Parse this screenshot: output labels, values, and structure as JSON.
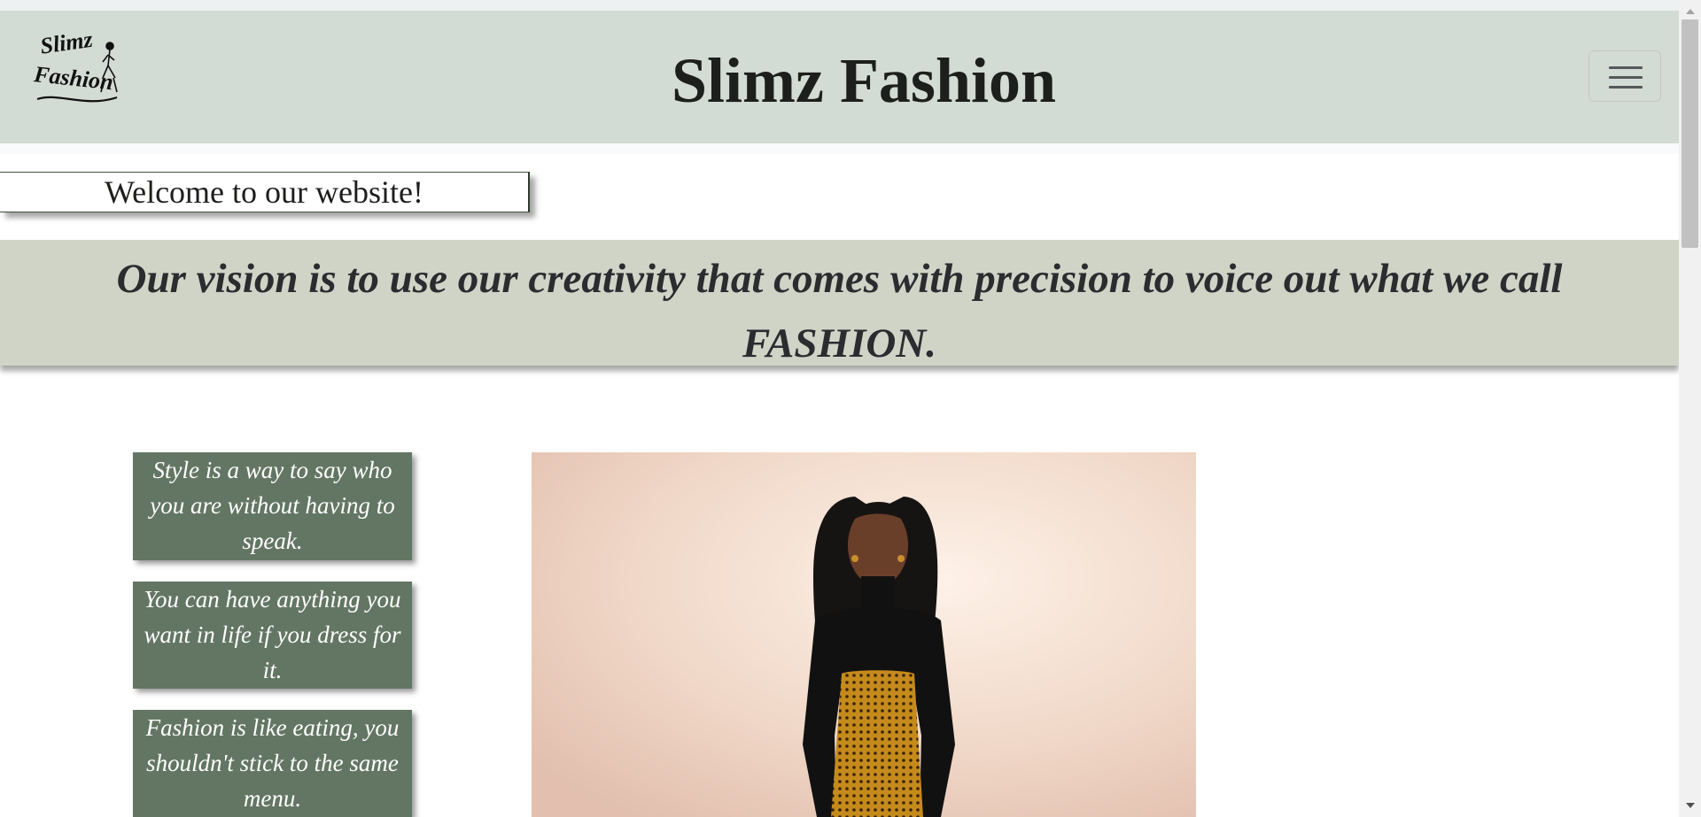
{
  "header": {
    "title": "Slimz Fashion",
    "logo_lines": [
      "Slimz",
      "Fashion"
    ],
    "menu_icon": "hamburger-menu-icon"
  },
  "welcome": {
    "text": "Welcome to our website!"
  },
  "vision": {
    "text": "Our vision is to use our creativity that comes with precision to voice out what we call FASHION."
  },
  "quotes": [
    {
      "text": "Style is a way to say who you are without having to speak."
    },
    {
      "text": "You can have anything you want in life if you dress for it."
    },
    {
      "text": "Fashion is like eating, you shouldn't stick to the same menu."
    }
  ],
  "hero": {
    "image": "model-portrait"
  },
  "colors": {
    "navbar_bg": "#d3dbd5",
    "vision_bg": "#cfd4c7",
    "quote_bg": "#637663",
    "text_dark": "#1d1f1c"
  }
}
